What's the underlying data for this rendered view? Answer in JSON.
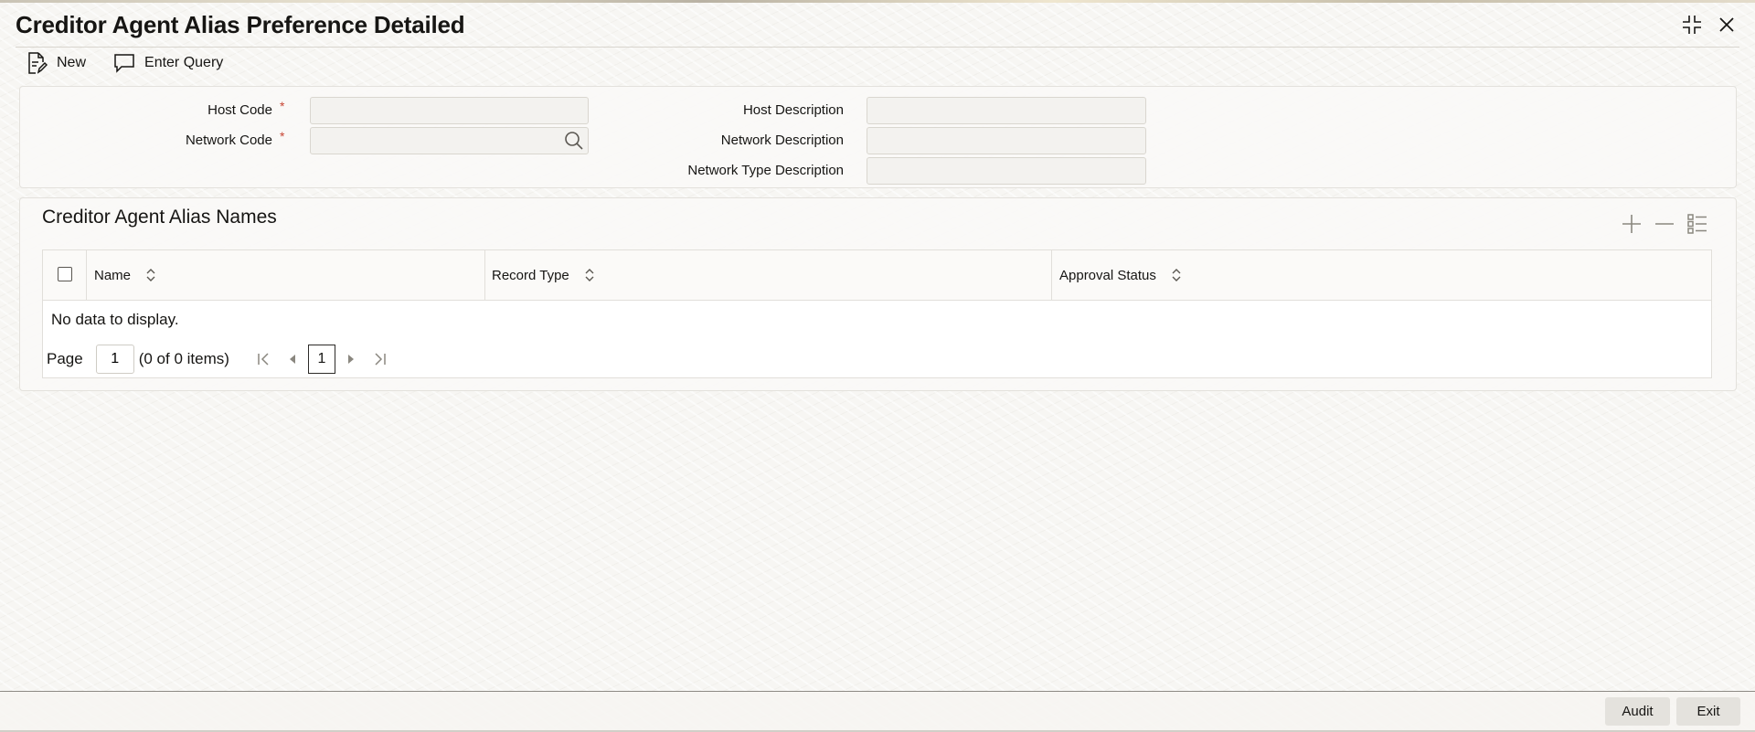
{
  "window": {
    "title": "Creditor Agent Alias Preference Detailed"
  },
  "toolbar": {
    "new_label": "New",
    "enter_query_label": "Enter Query"
  },
  "form": {
    "host_code": {
      "label": "Host Code",
      "required_mark": "*",
      "value": ""
    },
    "network_code": {
      "label": "Network Code",
      "required_mark": "*",
      "value": ""
    },
    "host_description": {
      "label": "Host Description",
      "value": ""
    },
    "network_description": {
      "label": "Network Description",
      "value": ""
    },
    "network_type_description": {
      "label": "Network Type Description",
      "value": ""
    }
  },
  "grid": {
    "title": "Creditor Agent Alias Names",
    "columns": [
      "Name",
      "Record Type",
      "Approval Status"
    ],
    "rows": [],
    "empty_message": "No data to display.",
    "pagination": {
      "page_label": "Page",
      "page_input": "1",
      "items_info": "(0 of 0 items)",
      "current_page": "1"
    }
  },
  "footer": {
    "audit_label": "Audit",
    "exit_label": "Exit"
  },
  "icons": {
    "maximize": "collapse-corners-icon",
    "close": "close-icon",
    "new": "new-document-icon",
    "enter_query": "speech-bubble-icon",
    "search": "search-icon",
    "add_row": "plus-icon",
    "delete_row": "minus-icon",
    "single_view": "list-detail-icon",
    "sort": "sort-updown-icon"
  },
  "colors": {
    "required": "#c74634",
    "text": "#161513",
    "border": "#d9d6cf"
  }
}
